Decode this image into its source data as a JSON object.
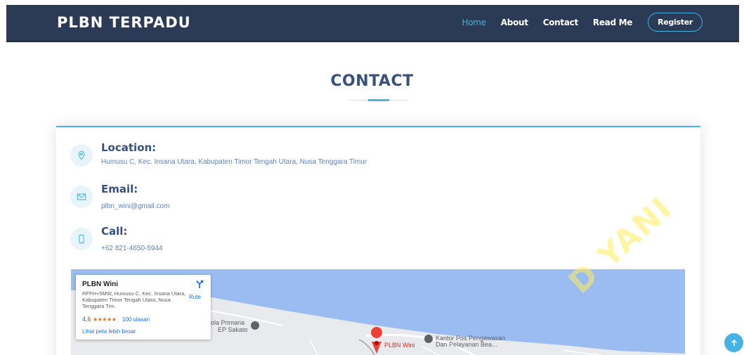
{
  "header": {
    "brand": "PLBN TERPADU",
    "nav": {
      "home": "Home",
      "about": "About",
      "contact": "Contact",
      "readme": "Read Me",
      "register": "Register"
    }
  },
  "section": {
    "title": "CONTACT"
  },
  "info": {
    "location": {
      "title": "Location:",
      "text": "Humusu C, Kec. Insana Utara, Kabupaten Timor Tengah Utara, Nusa Tenggara Timur",
      "icon": "location-pin-icon"
    },
    "email": {
      "title": "Email:",
      "text": "plbn_wini@gmail.com",
      "icon": "envelope-icon"
    },
    "call": {
      "title": "Call:",
      "text": "+62 821-4650-5944",
      "icon": "phone-icon"
    }
  },
  "map": {
    "place_name": "PLBN Wini",
    "address": "RFFH+5MW, Humusu C, Kec. Insana Utara, Kabupaten Timor Tengah Utara, Nusa Tenggara Tim.",
    "rating": "4,6",
    "stars": "★★★★★",
    "reviews": "100 ulasan",
    "larger_map": "Lihat peta lebih besar",
    "route": "Rute",
    "label_school": "ola Primaria",
    "label_school2": "EP Sakato",
    "label_pin": "PLBN Wini",
    "label_post1": "Kantor Pos Pengawasan",
    "label_post2": "Dan Pelayanan Bea..."
  },
  "watermark": "D YANI",
  "colors": {
    "header_bg": "#2b3a55",
    "accent": "#47b2e4",
    "title": "#37517e",
    "map_water": "#9bbcf0"
  }
}
